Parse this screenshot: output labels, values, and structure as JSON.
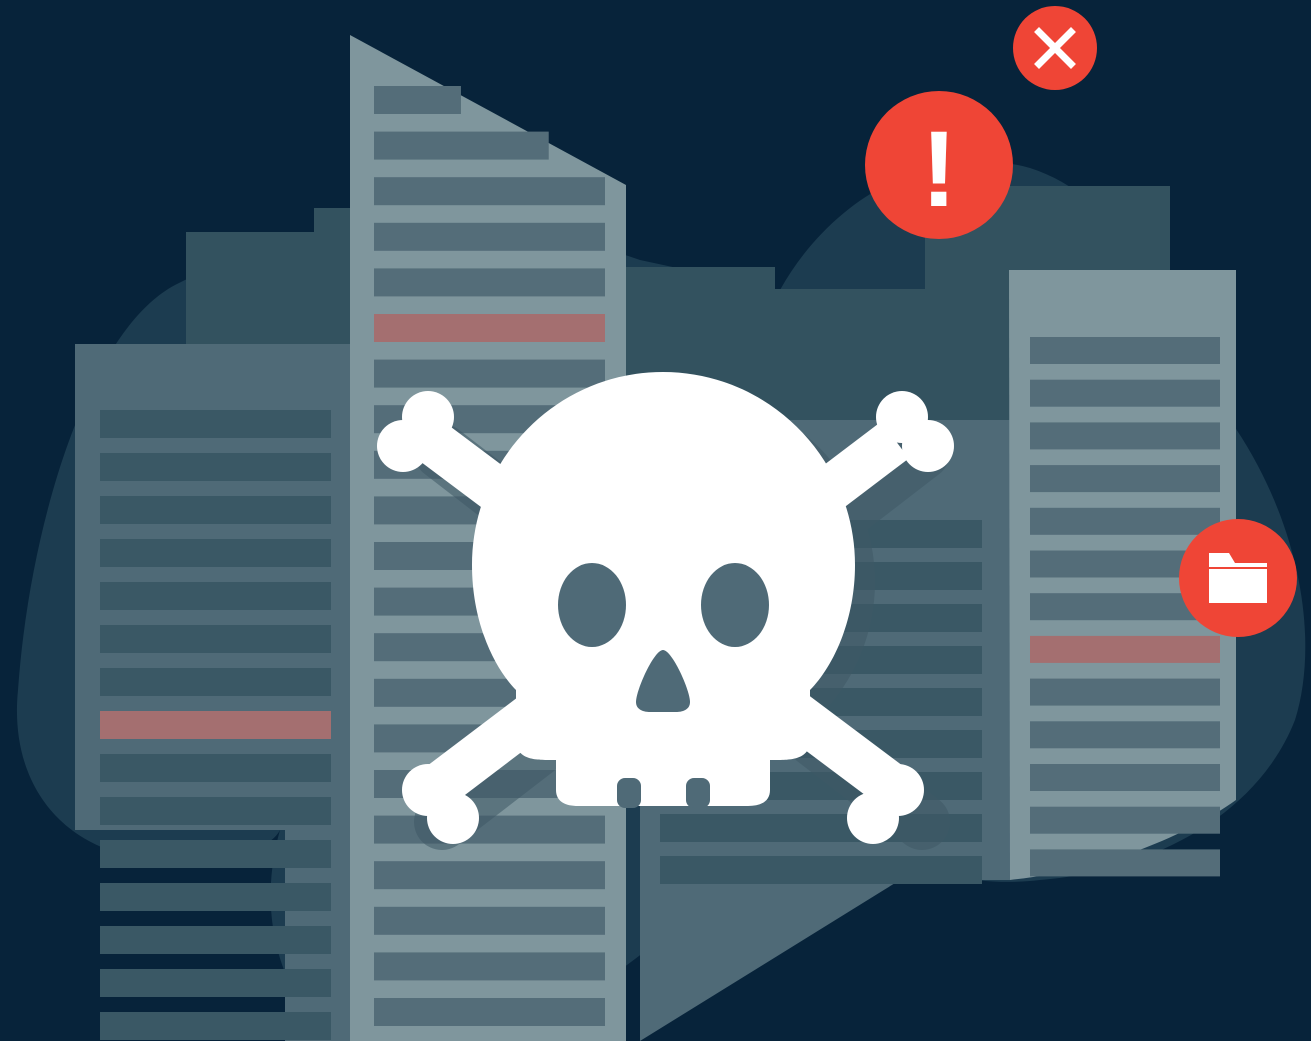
{
  "palette": {
    "background": "#07233a",
    "blob": "#1c3c50",
    "building_back": "#33525f",
    "building_mid": "#4f6a77",
    "building_front": "#7f969d",
    "window_dark": "#3a5865",
    "window_light": "#546d79",
    "window_alert": "#a46f70",
    "alert_red": "#ef4536",
    "skull": "#ffffff"
  },
  "icons": {
    "close_badge": "close-icon",
    "warning_badge": "exclamation-icon",
    "folder_badge": "folder-icon",
    "center": "skull-crossbones-icon"
  },
  "alert_windows": {
    "left_tower_row": 7,
    "tall_tower_row": 5,
    "right_tower_row": 7
  },
  "badge_text": {
    "warning": "!"
  }
}
